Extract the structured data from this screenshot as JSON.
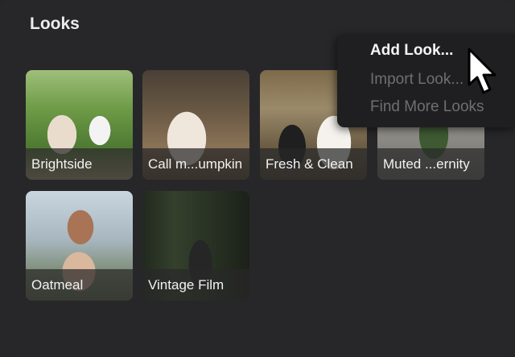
{
  "panel": {
    "title": "Looks"
  },
  "looks": [
    {
      "label": "Brightside"
    },
    {
      "label": "Call m...umpkin"
    },
    {
      "label": "Fresh & Clean"
    },
    {
      "label": "Muted ...ernity"
    },
    {
      "label": "Oatmeal"
    },
    {
      "label": "Vintage Film"
    }
  ],
  "context_menu": {
    "items": [
      {
        "label": "Add Look...",
        "state": "enabled"
      },
      {
        "label": "Import Look...",
        "state": "disabled"
      },
      {
        "label": "Find More Looks",
        "state": "disabled"
      }
    ]
  },
  "icons": {
    "cursor": "mouse-pointer-icon"
  }
}
